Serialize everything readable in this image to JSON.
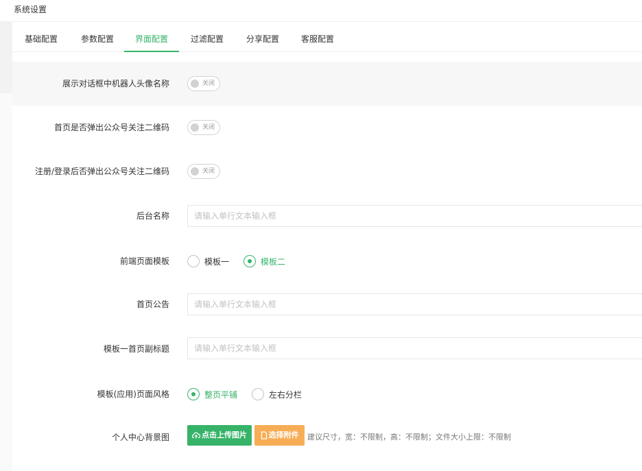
{
  "header": {
    "title": "系统设置"
  },
  "tabs": [
    {
      "label": "基础配置",
      "active": false
    },
    {
      "label": "参数配置",
      "active": false
    },
    {
      "label": "界面配置",
      "active": true
    },
    {
      "label": "过滤配置",
      "active": false
    },
    {
      "label": "分享配置",
      "active": false
    },
    {
      "label": "客服配置",
      "active": false
    }
  ],
  "form": {
    "show_robot_avatar": {
      "label": "展示对话框中机器人头像名称",
      "state": "关闭"
    },
    "home_popup_qrcode": {
      "label": "首页是否弹出公众号关注二维码",
      "state": "关闭"
    },
    "login_popup_qrcode": {
      "label": "注册/登录后否弹出公众号关注二维码",
      "state": "关闭"
    },
    "admin_name": {
      "label": "后台名称",
      "value": "",
      "placeholder": "请输入单行文本输入框"
    },
    "frontend_template": {
      "label": "前端页面模板",
      "options": [
        {
          "label": "模板一",
          "checked": false
        },
        {
          "label": "模板二",
          "checked": true
        }
      ]
    },
    "home_notice": {
      "label": "首页公告",
      "value": "",
      "placeholder": "请输入单行文本输入框"
    },
    "template1_subtitle": {
      "label": "模板一首页副标题",
      "value": "",
      "placeholder": "请输入单行文本输入框"
    },
    "app_page_style": {
      "label": "模板(应用)页面风格",
      "options": [
        {
          "label": "整页平铺",
          "checked": true
        },
        {
          "label": "左右分栏",
          "checked": false
        }
      ]
    },
    "profile_background": {
      "label": "个人中心背景图",
      "upload_label": "点击上传图片",
      "attachment_label": "选择附件",
      "hint": "建议尺寸，宽：不限制，高：不限制；文件大小上限：不限制"
    }
  },
  "colors": {
    "accent": "#36b368",
    "orange": "#f6ad55",
    "border": "#e6e6e6"
  }
}
